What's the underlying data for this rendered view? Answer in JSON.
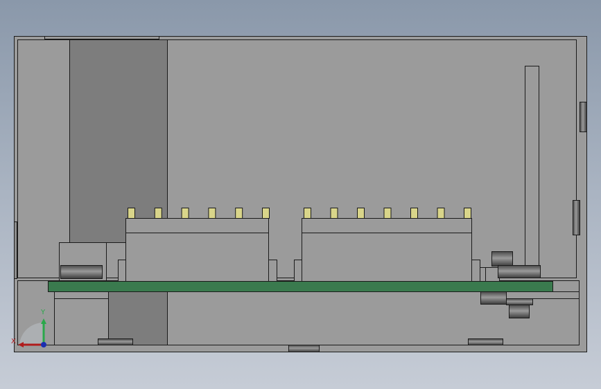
{
  "view": {
    "title": "",
    "colors": {
      "background_top": "#8a98aa",
      "background_bottom": "#c6ccd6",
      "part_gray": "#9b9b9b",
      "part_dark_gray": "#7d7d7d",
      "outline": "#1a1a1a",
      "pcb_green": "#3a7a4e",
      "pin_yellow": "#d9d58a"
    }
  },
  "triad": {
    "x_label": "X",
    "y_label": "Y",
    "x_color": "#b01c1c",
    "y_color": "#2aa84a",
    "z_color": "#1c2fb0"
  },
  "connectors": {
    "left_pin_count": 6,
    "right_pin_count": 7
  }
}
